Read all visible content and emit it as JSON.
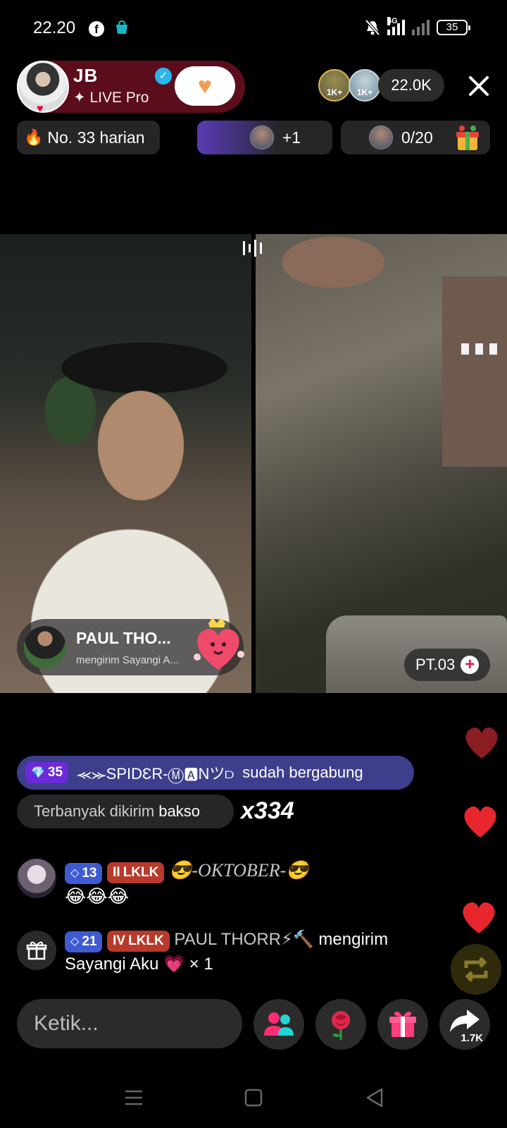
{
  "status_bar": {
    "time": "22.20",
    "network_label": "4G",
    "battery": "35"
  },
  "host": {
    "name": "JB",
    "subtitle": "LIVE Pro",
    "likes_badge": "1"
  },
  "viewers": {
    "avatar_a_label": "1K+",
    "avatar_b_label": "1K+",
    "count": "22.0K"
  },
  "rank": {
    "label": "No. 33 harian"
  },
  "guests": {
    "label": "+1"
  },
  "goal": {
    "label": "0/20"
  },
  "gift_banner": {
    "name": "PAUL THO...",
    "subtitle": "mengirim Sayangi A..."
  },
  "guest_tag": {
    "label": "PT.03"
  },
  "join_banner": {
    "level": "35",
    "user": "⪻⪼SPIDƐR-Ⓜ🅰Nツ⫐",
    "text": "sudah bergabung"
  },
  "top_gift": {
    "prefix": "Terbanyak dikirim",
    "item": "bakso",
    "combo": "x334"
  },
  "chat": [
    {
      "level": "13",
      "club_level": "II",
      "club": "LKLK",
      "username": "😎-OKTOBER-😎",
      "message": "😂😂😂"
    },
    {
      "level": "21",
      "club_level": "IV",
      "club": "LKLK",
      "username": "PAUL THORR⚡🔨",
      "message_a": "mengirim",
      "message_b": "Sayangi Aku",
      "message_c": "× 1"
    }
  ],
  "comment_input": {
    "placeholder": "Ketik..."
  },
  "share": {
    "count": "1.7K"
  },
  "icons": {
    "verify": "verified-badge-icon",
    "close": "close-icon",
    "gift": "gift-icon",
    "rose": "rose-icon",
    "multi_guest": "multi-guest-icon",
    "share": "share-arrow-icon"
  },
  "colors": {
    "host_card": "#5b0d1c",
    "join_banner": "#3d3f8c",
    "accent_pink": "#ff2d76",
    "heart_red": "#e8262e"
  }
}
